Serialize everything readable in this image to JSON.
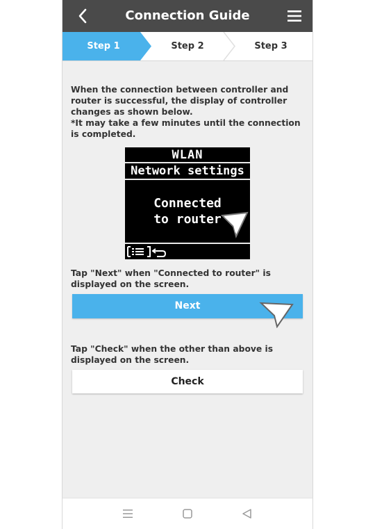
{
  "header": {
    "title": "Connection Guide",
    "back_icon": "chevron-left-icon",
    "menu_icon": "hamburger-menu-icon"
  },
  "steps": [
    {
      "label": "Step 1",
      "active": true
    },
    {
      "label": "Step 2",
      "active": false
    },
    {
      "label": "Step 3",
      "active": false
    }
  ],
  "intro": {
    "line1": "When the connection between controller and router is successful, the display of controller changes as shown below.",
    "line2": "*It may take a few minutes until the connection is completed."
  },
  "lcd": {
    "title": "WLAN",
    "subtitle": "Network settings",
    "message_line1": "Connected",
    "message_line2": "to router",
    "bottom_icons": [
      "menu-list-icon",
      "return-icon"
    ]
  },
  "next_section": {
    "instruction": "Tap \"Next\" when \"Connected to router\" is displayed on the screen.",
    "button_label": "Next"
  },
  "check_section": {
    "instruction": "Tap \"Check\" when the other than above is displayed on the screen.",
    "button_label": "Check"
  },
  "navbar": {
    "icons": [
      "recent-apps-icon",
      "home-icon",
      "back-triangle-icon"
    ]
  },
  "colors": {
    "header_bg": "#4a4a4a",
    "accent": "#4ab2eb",
    "page_bg": "#efefef"
  }
}
